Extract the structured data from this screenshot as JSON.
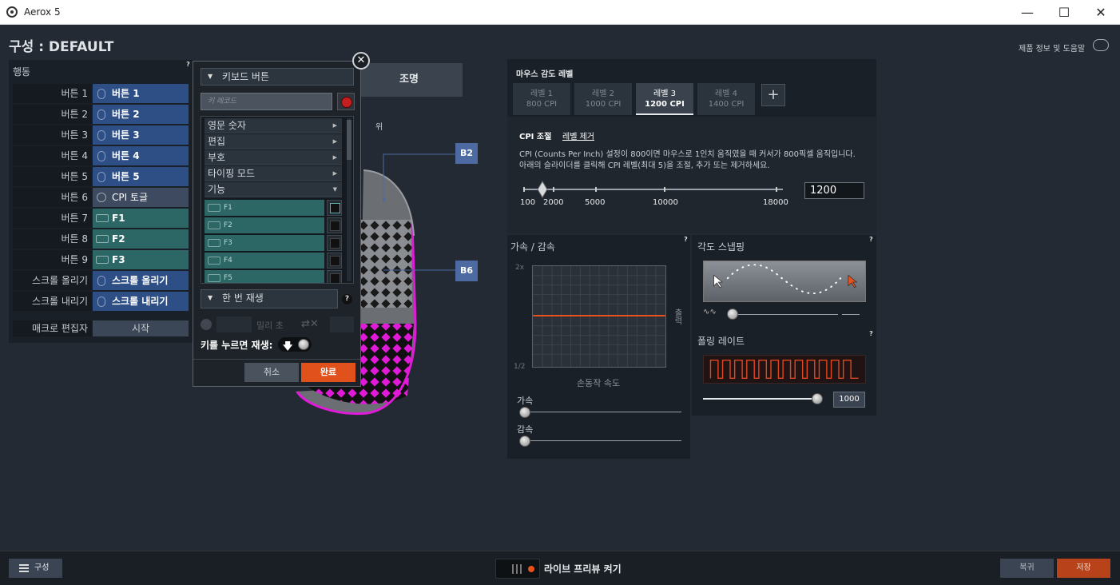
{
  "window": {
    "title": "Aerox 5",
    "minimize": "—",
    "maximize": "☐",
    "close": "✕"
  },
  "header": {
    "config_title": "구성 : DEFAULT",
    "help_link": "제품 정보 및 도움말"
  },
  "actions": {
    "label": "행동",
    "help": "?",
    "rows": [
      {
        "name": "버튼 1",
        "assign": "버튼 1",
        "kind": "mouse"
      },
      {
        "name": "버튼 2",
        "assign": "버튼 2",
        "kind": "mouse"
      },
      {
        "name": "버튼 3",
        "assign": "버튼 3",
        "kind": "mouse"
      },
      {
        "name": "버튼 4",
        "assign": "버튼 4",
        "kind": "mouse"
      },
      {
        "name": "버튼 5",
        "assign": "버튼 5",
        "kind": "mouse"
      },
      {
        "name": "버튼 6",
        "assign": "CPI 토글",
        "kind": "cpi"
      },
      {
        "name": "버튼 7",
        "assign": "F1",
        "kind": "key"
      },
      {
        "name": "버튼 8",
        "assign": "F2",
        "kind": "key"
      },
      {
        "name": "버튼 9",
        "assign": "F3",
        "kind": "key"
      },
      {
        "name": "스크롤 올리기",
        "assign": "스크롤 올리기",
        "kind": "mouse"
      },
      {
        "name": "스크롤 내리기",
        "assign": "스크롤 내리기",
        "kind": "mouse"
      }
    ],
    "macro_editor": "매크로 편집자",
    "start": "시작"
  },
  "tabs": {
    "lighting": "조명",
    "view_top": "위"
  },
  "callouts": {
    "b2": "B2",
    "b6": "B6"
  },
  "popup": {
    "type_dropdown": "키보드 버튼",
    "record_placeholder": "키 레코드",
    "categories": [
      {
        "label": "영문 숫자",
        "chev": "▶"
      },
      {
        "label": "편집",
        "chev": "▶"
      },
      {
        "label": "부호",
        "chev": "▶"
      },
      {
        "label": "타이핑 모드",
        "chev": "▶"
      },
      {
        "label": "기능",
        "chev": "▼"
      }
    ],
    "keys": [
      {
        "label": "F1",
        "checked": true
      },
      {
        "label": "F2",
        "checked": false
      },
      {
        "label": "F3",
        "checked": false
      },
      {
        "label": "F4",
        "checked": false
      },
      {
        "label": "F5",
        "checked": false
      }
    ],
    "play_mode": "한 번 재생",
    "play_help": "?",
    "delay_label": "밀리 초",
    "hold_label": "키를 누르면 재생:",
    "cancel": "취소",
    "done": "완료",
    "close": "✕"
  },
  "sensitivity": {
    "title": "마우스 감도 레벨",
    "levels": [
      {
        "name": "레벨 1",
        "cpi": "800 CPI",
        "active": false
      },
      {
        "name": "레벨 2",
        "cpi": "1000 CPI",
        "active": false
      },
      {
        "name": "레벨 3",
        "cpi": "1200 CPI",
        "active": true
      },
      {
        "name": "레벨 4",
        "cpi": "1400 CPI",
        "active": false
      }
    ],
    "add": "+",
    "tab_cpi": "CPI 조절",
    "tab_remove": "레벨 제거",
    "desc1": "CPI (Counts Per Inch) 설정이 800이면 마우스로 1인치 움직였을 때 커서가 800픽셀 움직입니다.",
    "desc2": "아래의 슬라이더를 클릭해 CPI 레벨(최대 5)을 조절, 추가 또는 제거하세요.",
    "ticks": [
      "100",
      "2000",
      "5000",
      "10000",
      "18000"
    ],
    "cpi_value": "1200"
  },
  "accel": {
    "title": "가속 / 감속",
    "help": "?",
    "y_top": "2x",
    "y_bottom": "1/2",
    "y_right": "출력",
    "x_label": "손동작 속도",
    "accel_label": "가속",
    "decel_label": "감속"
  },
  "angle": {
    "title": "각도 스냅핑",
    "help": "?"
  },
  "polling": {
    "title": "폴링 레이트",
    "help": "?",
    "value": "1000"
  },
  "bottom": {
    "config": "구성",
    "live_preview": "라이브 프리뷰 켜기",
    "reset": "복귀",
    "save": "저장"
  }
}
